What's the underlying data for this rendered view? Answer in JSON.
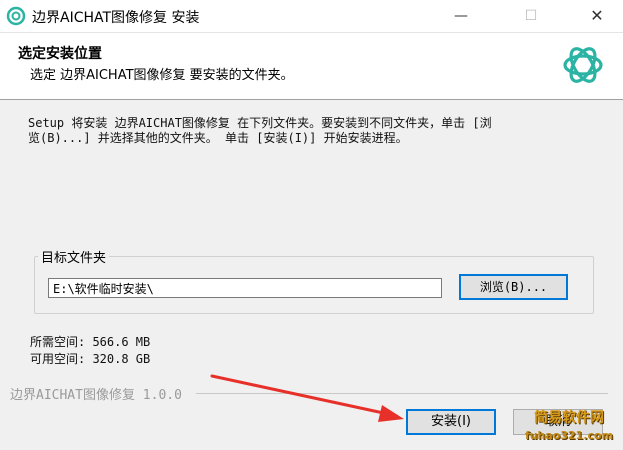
{
  "window": {
    "title": "边界AICHAT图像修复 安装",
    "minimize": "—",
    "maximize": "☐",
    "close": "✕"
  },
  "header": {
    "title": "选定安装位置",
    "subtitle": "选定 边界AICHAT图像修复 要安装的文件夹。"
  },
  "intro": {
    "line1": "Setup 将安装 边界AICHAT图像修复 在下列文件夹。要安装到不同文件夹，单击 [浏",
    "line2": "览(B)...] 并选择其他的文件夹。 单击 [安装(I)] 开始安装进程。"
  },
  "destination": {
    "group_label": "目标文件夹",
    "path_value": "E:\\软件临时安装\\",
    "browse_label": "浏览(B)..."
  },
  "space": {
    "required": "所需空间: 566.6 MB",
    "available": "可用空间: 320.8 GB"
  },
  "footer": {
    "branding": "边界AICHAT图像修复 1.0.0",
    "install_label": "安装(I)",
    "cancel_label": "取消"
  },
  "watermark": {
    "text": "简易软件网",
    "url": "fuhao321.com"
  },
  "colors": {
    "accent": "#0078d7",
    "logo": "#2bb3a3",
    "arrow": "#e8302a"
  },
  "icons": {
    "app": "teal-knot-icon",
    "logo": "teal-knot-logo-icon"
  }
}
